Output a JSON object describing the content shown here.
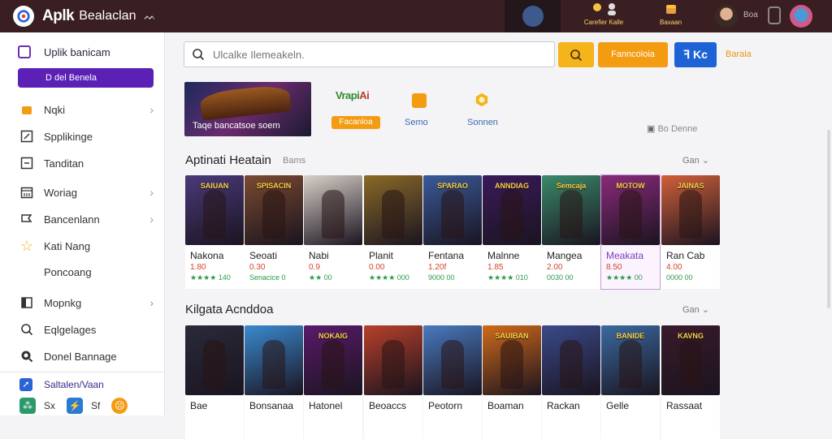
{
  "header": {
    "app_name": "Aplk",
    "app_subtitle": "Bealaclan",
    "wave": "ᨓ",
    "cluster1_label": "Carefier Kalle",
    "cluster2_label": "Baxaan",
    "user_text": "Boa",
    "colors": {
      "bar": "#3a1f22",
      "accent": "#ffd36a"
    }
  },
  "sidebar": {
    "head": "Uplik banicam",
    "button": "D del Benela",
    "items": [
      {
        "label": "Nqki",
        "icon": "bag-icon",
        "chevron": true
      },
      {
        "label": "Spplikinge",
        "icon": "edit-icon",
        "chevron": false
      },
      {
        "label": "Tanditan",
        "icon": "minus-square-icon",
        "chevron": false
      },
      {
        "label": "Woriag",
        "icon": "calendar-icon",
        "chevron": true
      },
      {
        "label": "Bancenlann",
        "icon": "flag-icon",
        "chevron": true
      },
      {
        "label": "Kati Nang",
        "icon": "star-icon",
        "chevron": false
      },
      {
        "label": "Poncoang",
        "icon": "",
        "chevron": false
      },
      {
        "label": "Mopnkg",
        "icon": "box-icon",
        "chevron": true
      },
      {
        "label": "Eqlgelages",
        "icon": "search-icon",
        "chevron": false
      },
      {
        "label": "Donel Bannage",
        "icon": "zoom-icon",
        "chevron": false
      }
    ],
    "footer_title": "Saltalen/Vaan",
    "footer_items": [
      "Sx",
      "Sf"
    ]
  },
  "search": {
    "placeholder": "Ulcalke Ilemeakeln."
  },
  "toolbar": {
    "orange_label": "Fanncoloia",
    "blue_label": "ꟻ Kc",
    "link_label": "Barala"
  },
  "hero": {
    "banner_text": "Taqe bancatsoe soem",
    "tile_logo_a": "Vrapi",
    "tile_logo_b": "Ai",
    "pill": "Facanloa",
    "tile2_label": "Semo",
    "tile3_label": "Sonnen",
    "right_text": "Bo Denne"
  },
  "sections": [
    {
      "title": "Aptinati Heatain",
      "subtitle": "Bams",
      "more": "Gan",
      "cards": [
        {
          "caption": "SAIUAN",
          "name": "Nakona",
          "price": "1.80",
          "rating": "★★★★ 140",
          "bg": "#4a3a7a"
        },
        {
          "caption": "SPISACIN",
          "name": "Seoati",
          "price": "0.30",
          "rating": "Senacice 0",
          "bg": "#7a4a30"
        },
        {
          "caption": "",
          "name": "Nabi",
          "price": "0.9",
          "rating": "★★ 00",
          "bg": "#d8d0c8"
        },
        {
          "caption": "",
          "name": "Planit",
          "price": "0.00",
          "rating": "★★★★ 000",
          "bg": "#8a6a28"
        },
        {
          "caption": "SPARAO",
          "name": "Fentana",
          "price": "1.20f",
          "rating": "9000 00",
          "bg": "#3a5a9a"
        },
        {
          "caption": "ANNDIAG",
          "name": "Malnne",
          "price": "1.85",
          "rating": "★★★★ 010",
          "bg": "#3a1a5a"
        },
        {
          "caption": "Semcaja",
          "name": "Mangea",
          "price": "2.00",
          "rating": "0030 00",
          "bg": "#3a8a6a"
        },
        {
          "caption": "MOTOW",
          "name": "Meakata",
          "price": "8.50",
          "rating": "★★★★ 00",
          "bg": "#8a2a7a"
        },
        {
          "caption": "JAINAS",
          "name": "Ran Cab",
          "price": "4.00",
          "rating": "0000 00",
          "bg": "#d0603a"
        }
      ]
    },
    {
      "title": "Kilgata Acnddoa",
      "subtitle": "",
      "more": "Gan",
      "cards": [
        {
          "caption": "",
          "name": "Bae",
          "bg": "#2a2a3a"
        },
        {
          "caption": "",
          "name": "Bonsanaa",
          "bg": "#3a8ad0"
        },
        {
          "caption": "NOKAIG",
          "name": "Hatonel",
          "bg": "#5a1a6a"
        },
        {
          "caption": "",
          "name": "Beoaccs",
          "bg": "#b8402a"
        },
        {
          "caption": "",
          "name": "Peotorn",
          "bg": "#4a7ac0"
        },
        {
          "caption": "SAUIBAN",
          "name": "Boaman",
          "bg": "#d06a1a"
        },
        {
          "caption": "",
          "name": "Rackan",
          "bg": "#3a4a8a"
        },
        {
          "caption": "BANIDE",
          "name": "Gelle",
          "bg": "#3a6aa0"
        },
        {
          "caption": "KAVNG",
          "name": "Rassaat",
          "bg": "#3a1a2a"
        }
      ]
    }
  ]
}
